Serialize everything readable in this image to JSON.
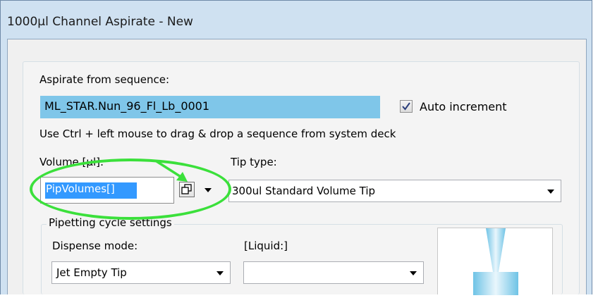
{
  "window": {
    "title": "1000µl Channel Aspirate - New"
  },
  "aspirate": {
    "label": "Aspirate from sequence:",
    "sequence_value": "ML_STAR.Nun_96_Fl_Lb_0001",
    "auto_increment_label": "Auto increment",
    "auto_increment_checked": true,
    "hint": "Use Ctrl + left mouse to drag & drop a sequence from system deck"
  },
  "volume": {
    "label": "Volume [µl]:",
    "value": "PipVolumes[]"
  },
  "tip_type": {
    "label": "Tip type:",
    "value": "300ul Standard Volume Tip"
  },
  "pipetting_cycle": {
    "group_label": "Pipetting cycle settings",
    "dispense_mode_label": "Dispense mode:",
    "dispense_mode_value": "Jet Empty Tip",
    "liquid_label": "[Liquid:]",
    "liquid_value": ""
  },
  "colors": {
    "annotation": "#3be03b",
    "selection": "#3399ff",
    "sequence_highlight": "#7fc6e9"
  },
  "icons": [
    "copy-icon",
    "checkmark-icon",
    "chevron-down-icon",
    "green-arrow-annotation",
    "tip-preview-image"
  ]
}
